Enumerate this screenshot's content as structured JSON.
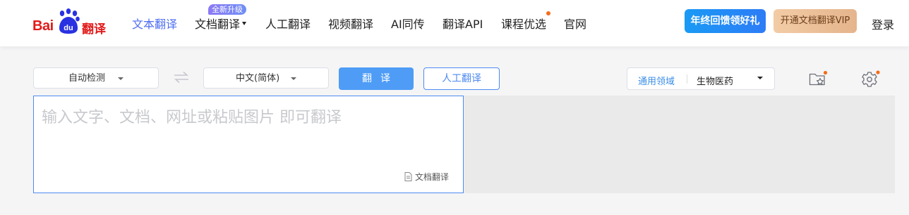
{
  "logo": {
    "bai": "Bai",
    "du": "du",
    "fanyi": "翻译"
  },
  "nav": {
    "items": [
      {
        "label": "文本翻译"
      },
      {
        "label": "文档翻译"
      },
      {
        "label": "人工翻译"
      },
      {
        "label": "视频翻译"
      },
      {
        "label": "AI同传"
      },
      {
        "label": "翻译API"
      },
      {
        "label": "课程优选"
      },
      {
        "label": "官网"
      }
    ],
    "active_index": 0,
    "upgrade_badge": "全新升级"
  },
  "header": {
    "promo_button": "年终回馈领好礼",
    "vip_button": "开通文档翻译VIP",
    "login": "登录"
  },
  "toolbar": {
    "source_lang": "自动检测",
    "target_lang": "中文(简体)",
    "translate_button": "翻译",
    "human_button": "人工翻译",
    "domain_label": "通用领域",
    "domain_value": "生物医药"
  },
  "input": {
    "placeholder": "输入文字、文档、网址或粘贴图片 即可翻译",
    "doc_link": "文档翻译"
  },
  "colors": {
    "accent": "#4e8af2",
    "brand_red": "#e21a1a",
    "promo_blue": "#1a9af5",
    "notification": "#f46d1c"
  },
  "icons": [
    "paw-logo-icon",
    "swap-icon",
    "favorites-icon",
    "settings-gear-icon",
    "document-icon"
  ]
}
